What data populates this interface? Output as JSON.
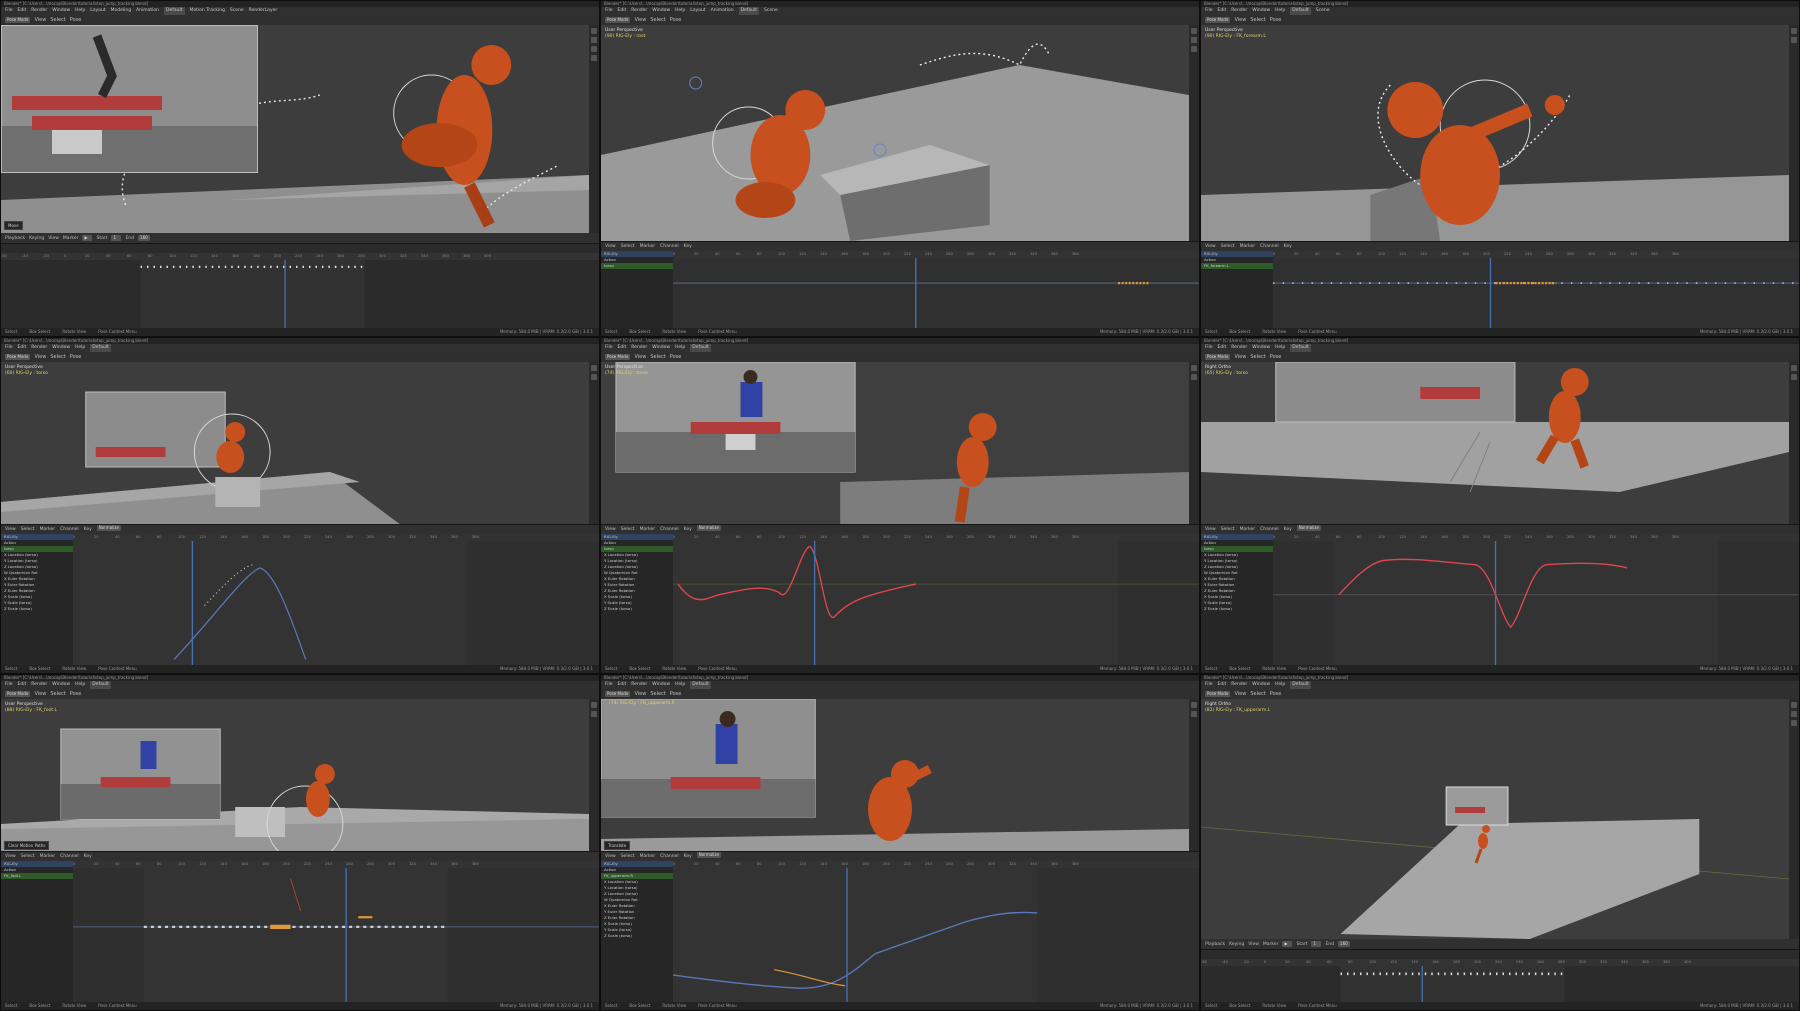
{
  "common": {
    "title": "Blender* [C:\\Users\\...\\mocap\\Blender\\tutorial\\step_jump_tracking.blend]",
    "menu": [
      "File",
      "Edit",
      "Render",
      "Window",
      "Help"
    ],
    "workspaces": [
      "Layout",
      "Modeling",
      "Sculpting",
      "UV Editing",
      "Texture Paint",
      "Shading",
      "Animation",
      "Rendering",
      "Compositing",
      "Default",
      "Geometry Nodes",
      "Motion Tracking",
      "Video Editing",
      "Scripting"
    ],
    "active_workspace": "Default",
    "scene": "Scene",
    "view_layer": "RenderLayer",
    "mode": "Pose Mode",
    "vp_menu": [
      "View",
      "Select",
      "Pose"
    ],
    "ed_menu": [
      "View",
      "Select",
      "Marker",
      "Channel",
      "Key"
    ],
    "normalize": "Normalize",
    "ruler": [
      "-60",
      "-40",
      "-20",
      "0",
      "20",
      "40",
      "60",
      "80",
      "100",
      "120",
      "140",
      "160",
      "180",
      "200",
      "220",
      "240",
      "260",
      "280",
      "300",
      "320",
      "340",
      "360",
      "380",
      "400"
    ],
    "status_left": [
      "Select",
      "Box Select",
      "Rotate View",
      "Pose Context Menu"
    ],
    "memory": "Memory: 584.0 MiB | VRAM: 0.3/2.0 GiB | 3.0.1"
  },
  "panes": [
    {
      "view": "User Perspective",
      "object": "(90) RIG-Ely",
      "editor": "Timeline",
      "notice": "Move"
    },
    {
      "view": "User Perspective",
      "object": "(90) RIG-Ely : root",
      "editor": "Dope Sheet"
    },
    {
      "view": "User Perspective",
      "object": "(90) RIG-Ely : FK_forearm.L",
      "editor": "Dope Sheet"
    },
    {
      "view": "User Perspective",
      "object": "(60) RIG-Ely : torso",
      "editor": "Graph Editor"
    },
    {
      "view": "User Perspective",
      "object": "(74) RIG-Ely : torso",
      "editor": "Graph Editor"
    },
    {
      "view": "Right Ortho",
      "object": "(65) RIG-Ely : torso",
      "editor": "Graph Editor"
    },
    {
      "view": "User Perspective",
      "object": "(88) RIG-Ely : FK_foot.L",
      "editor": "Dope Sheet",
      "notice": "Clear Motion Paths"
    },
    {
      "view": "User Perspective",
      "object": "(74) RIG-Ely : FK_upperarm.R",
      "editor": "Graph Editor",
      "notice": "Translate"
    },
    {
      "view": "Right Ortho",
      "object": "(82) RIG-Ely : FK_upperarm.L",
      "editor": "Timeline"
    }
  ],
  "channels": {
    "rig": "RIG-Ely",
    "action": "Action",
    "bones": [
      "torso",
      "FK_forearm.L",
      "FK_foot.L",
      "FK_upperarm.R"
    ],
    "curves": [
      "X Location (torso)",
      "Y Location (torso)",
      "Z Location (torso)",
      "W Quaternion Rot",
      "X Euler Rotation",
      "Y Euler Rotation",
      "Z Euler Rotation",
      "X Scale (torso)",
      "Y Scale (torso)",
      "Z Scale (torso)"
    ]
  },
  "playback": {
    "playback": "Playback",
    "keying": "Keying",
    "view": "View",
    "marker": "Marker",
    "start_label": "Start",
    "start": "1",
    "end_label": "End",
    "end": "160"
  },
  "colors": {
    "figure": "#c8501e",
    "figure_dark": "#8f3512",
    "accent": "#4772b3",
    "curve": "#e0474c"
  }
}
